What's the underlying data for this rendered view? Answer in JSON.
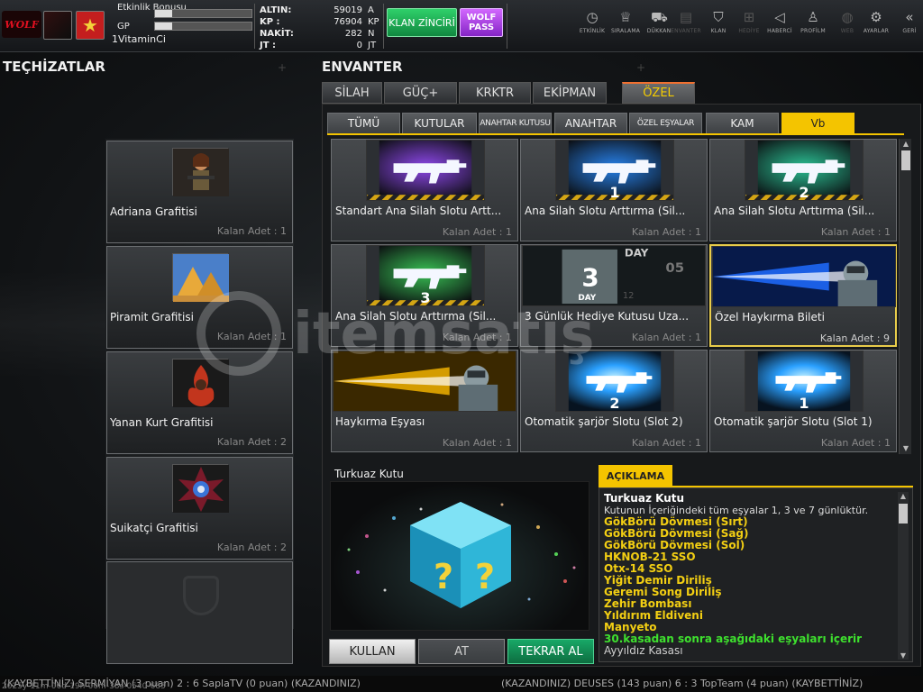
{
  "player": {
    "logo_text": "WOLF",
    "name": "1VitaminCi",
    "stats": [
      {
        "label": "Etkinlik Bonusu",
        "progress": 0.18
      },
      {
        "label": "GP",
        "progress": 0.18
      }
    ]
  },
  "currency": [
    {
      "label": "ALTIN:",
      "value": "59019",
      "unit": "A"
    },
    {
      "label": "KP :",
      "value": "76904",
      "unit": "KP"
    },
    {
      "label": "NAKİT:",
      "value": "282",
      "unit": "N"
    },
    {
      "label": "JT :",
      "value": "0",
      "unit": "JT"
    }
  ],
  "buttons": {
    "klan_zinciri": "KLAN ZİNCİRİ",
    "wolf_pass": "WOLF PASS",
    "kullan": "KULLAN",
    "at": "AT",
    "tekrar_al": "TEKRAR AL"
  },
  "top_nav": [
    {
      "label": "ETKİNLİK",
      "icon": "stopwatch-icon",
      "glyph": "◷",
      "enabled": true
    },
    {
      "label": "SIRALAMA",
      "icon": "medal-icon",
      "glyph": "♕",
      "enabled": true
    },
    {
      "label": "DÜKKAN",
      "icon": "cart-icon",
      "glyph": "⛟",
      "enabled": true
    },
    {
      "label": "ENVANTER",
      "icon": "inventory-icon",
      "glyph": "▤",
      "enabled": false
    },
    {
      "label": "KLAN",
      "icon": "clan-shield-icon",
      "glyph": "⛉",
      "enabled": true
    },
    {
      "label": "HEDİYE",
      "icon": "gift-icon",
      "glyph": "⊞",
      "enabled": false
    },
    {
      "label": "HABERCİ",
      "icon": "megaphone-icon",
      "glyph": "◁",
      "enabled": true
    },
    {
      "label": "PROFİLM",
      "icon": "profile-icon",
      "glyph": "♙",
      "enabled": true
    },
    {
      "label": "WEB",
      "icon": "globe-icon",
      "glyph": "◍",
      "enabled": false
    },
    {
      "label": "AYARLAR",
      "icon": "gear-icon",
      "glyph": "⚙",
      "enabled": true
    },
    {
      "label": "GERİ",
      "icon": "back-chevron-icon",
      "glyph": "«",
      "enabled": true
    }
  ],
  "sections": {
    "equipment_title": "TEÇHİZATLAR",
    "inventory_title": "ENVANTER"
  },
  "equipment": [
    {
      "name": "Adriana Grafitisi",
      "qty": "Kalan Adet : 1",
      "icon": "adriana-graffiti-icon"
    },
    {
      "name": "Piramit Grafitisi",
      "qty": "Kalan Adet : 1",
      "icon": "pyramid-graffiti-icon"
    },
    {
      "name": "Yanan Kurt Grafitisi",
      "qty": "Kalan Adet : 2",
      "icon": "burning-wolf-graffiti-icon"
    },
    {
      "name": "Suikatçi Grafitisi",
      "qty": "Kalan Adet : 2",
      "icon": "assassin-graffiti-icon"
    }
  ],
  "main_tabs": [
    {
      "label": "SİLAH",
      "active": false
    },
    {
      "label": "GÜÇ+",
      "active": false
    },
    {
      "label": "KRKTR",
      "active": false
    },
    {
      "label": "EKİPMAN",
      "active": false
    },
    {
      "label": "ÖZEL",
      "active": true
    }
  ],
  "sub_tabs": [
    {
      "label": "TÜMÜ",
      "active": false
    },
    {
      "label": "KUTULAR",
      "active": false
    },
    {
      "label": "ANAHTAR KUTUSU",
      "active": false
    },
    {
      "label": "ANAHTAR",
      "active": false
    },
    {
      "label": "ÖZEL EŞYALAR",
      "active": false
    },
    {
      "label": "KAM",
      "active": false
    },
    {
      "label": "Vb",
      "active": true
    }
  ],
  "items": [
    {
      "name": "Standart Ana Silah Slotu Artt...",
      "qty": "Kalan Adet : 1",
      "icon": "purple-rifle-slot-icon",
      "color": "#9a4dff",
      "badge": ""
    },
    {
      "name": "Ana Silah Slotu Arttırma (Sil...",
      "qty": "Kalan Adet : 1",
      "icon": "blue-rifle-slot-1-icon",
      "color": "#2a8cff",
      "badge": "1"
    },
    {
      "name": "Ana Silah Slotu Arttırma (Sil...",
      "qty": "Kalan Adet : 1",
      "icon": "green-rifle-slot-2-icon",
      "color": "#2ed0a0",
      "badge": "2"
    },
    {
      "name": "Ana Silah Slotu Arttırma (Sil...",
      "qty": "Kalan Adet : 1",
      "icon": "green-rifle-slot-3-icon",
      "color": "#3cd05a",
      "badge": "3"
    },
    {
      "name": "3 Günlük Hediye Kutusu Uza...",
      "qty": "Kalan Adet : 1",
      "icon": "three-day-gift-icon",
      "color": "#777777",
      "badge": "3"
    },
    {
      "name": "Özel Haykırma Bileti",
      "qty": "Kalan Adet : 9",
      "icon": "special-shout-ticket-icon",
      "color": "#1e6cff",
      "badge": ""
    },
    {
      "name": "Haykırma Eşyası",
      "qty": "Kalan Adet : 1",
      "icon": "shout-item-icon",
      "color": "#f0b000",
      "badge": ""
    },
    {
      "name": "Otomatik şarjör Slotu (Slot 2)",
      "qty": "Kalan Adet : 1",
      "icon": "auto-magazine-slot-2-icon",
      "color": "#36c4ff",
      "badge": "2"
    },
    {
      "name": "Otomatik şarjör Slotu (Slot 1)",
      "qty": "Kalan Adet : 1",
      "icon": "auto-magazine-slot-1-icon",
      "color": "#36c4ff",
      "badge": "1"
    }
  ],
  "gift_box": {
    "day_word": "DAY",
    "side_number": "05",
    "small_number": "12"
  },
  "detail": {
    "name": "Turkuaz Kutu",
    "tab_label": "AÇIKLAMA",
    "desc_title": "Turkuaz Kutu",
    "desc_intro": "Kutunun İçeriğindeki tüm eşyalar 1, 3 ve 7 günlüktür.",
    "yellow_items": [
      "GökBörü Dövmesi (Sırt)",
      "GökBörü Dövmesi (Sağ)",
      "GökBörü Dövmesi (Sol)",
      "HKNOB-21 SSO",
      "Otx-14 SSO",
      "Yiğit Demir Diriliş",
      "Geremi Song Diriliş",
      "Zehir Bombası",
      "Yıldırım Eldiveni",
      "Manyeto"
    ],
    "green_note": "30.kasadan sonra aşağıdaki eşyaları içerir",
    "extra_item": "Ayyıldız Kasası"
  },
  "ticker": {
    "left": "(KAYBETTİNİZ) SERMİYAN (3 puan) 2 : 6 SaplaTV (0 puan) (KAZANDINIZ)",
    "right": "(KAZANDINIZ) DEUSES (143 puan) 6 : 3 TopTeam (4 puan) (KAYBETTİNİZ)",
    "clock": "2025y-11m-06d-19h-00m-38s-0540-685"
  },
  "watermark": "itemsatış"
}
